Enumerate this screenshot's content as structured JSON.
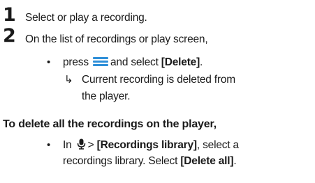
{
  "steps": [
    {
      "number": "1",
      "text": "Select or play a recording."
    },
    {
      "number": "2",
      "text": "On the list of recordings or play screen,"
    }
  ],
  "step2_bullet": {
    "prefix": "press",
    "icon": "menu-icon",
    "middle": "and select",
    "action": "[Delete]",
    "suffix": "."
  },
  "step2_result": {
    "arrow": "↳",
    "line1": "Current recording is deleted from",
    "line2": "the player."
  },
  "delete_all": {
    "heading": "To delete all the recordings on the player,",
    "bullet_prefix": "In",
    "icon": "microphone-icon",
    "separator": ">",
    "library": "[Recordings library]",
    "after_library": ", select a",
    "line2_prefix": "recordings library. Select",
    "delete_all_action": "[Delete all]",
    "line2_suffix": "."
  },
  "bullet_glyph": "•",
  "colors": {
    "text": "#1a1a1a",
    "menu_icon": "#2f8fd8"
  }
}
